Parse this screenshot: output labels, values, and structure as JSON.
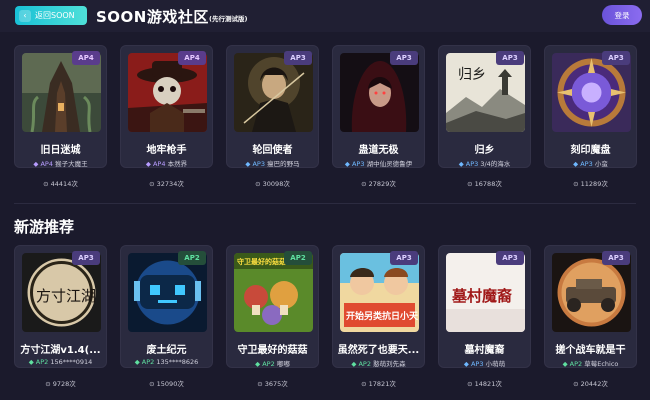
{
  "header": {
    "back_label": "返回SOON",
    "title": "SOON游戏社区",
    "subtitle": "(先行测试版)",
    "login_label": "登录"
  },
  "colors": {
    "background": "#1b1a2c",
    "card": "#2a2a3f",
    "accent_teal": "#19c0d6",
    "accent_purple": "#7b5fe8",
    "ap2_green": "#5fe0a0"
  },
  "top_games": [
    {
      "name": "旧日迷城",
      "tag": "AP4",
      "author_ver": "AP4",
      "author": "猴子大魔王",
      "plays": "44414次"
    },
    {
      "name": "地牢枪手",
      "tag": "AP4",
      "author_ver": "AP4",
      "author": "本然界",
      "plays": "32734次"
    },
    {
      "name": "轮回使者",
      "tag": "AP3",
      "author_ver": "AP3",
      "author": "瘦巴的野马",
      "plays": "30098次"
    },
    {
      "name": "蛊道无极",
      "tag": "AP3",
      "author_ver": "AP3",
      "author": "湖中仙灵德鲁伊",
      "plays": "27829次"
    },
    {
      "name": "归乡",
      "tag": "AP3",
      "author_ver": "AP3",
      "author": "3/4的海水",
      "plays": "16788次"
    },
    {
      "name": "刻印魔盘",
      "tag": "AP3",
      "author_ver": "AP3",
      "author": "小蛮",
      "plays": "11289次"
    }
  ],
  "new_section_title": "新游推荐",
  "new_games": [
    {
      "name": "方寸江湖v1.4(...",
      "tag": "AP3",
      "author_ver": "AP2",
      "author": "156****0914",
      "plays": "9728次"
    },
    {
      "name": "废土纪元",
      "tag": "AP2",
      "author_ver": "AP2",
      "author": "135****8626",
      "plays": "15090次"
    },
    {
      "name": "守卫最好的菇菇",
      "tag": "AP2",
      "author_ver": "AP2",
      "author": "嘟嘟",
      "plays": "3675次"
    },
    {
      "name": "虽然死了也要天...",
      "tag": "AP3",
      "author_ver": "AP2",
      "author": "憨萌刘先森",
      "plays": "17821次"
    },
    {
      "name": "墓村魔裔",
      "tag": "AP3",
      "author_ver": "AP3",
      "author": "小萌萌",
      "plays": "14821次"
    },
    {
      "name": "搓个战车就是干",
      "tag": "AP3",
      "author_ver": "AP2",
      "author": "草莓Echico",
      "plays": "20442次"
    }
  ],
  "thumb_text": {
    "guixiang": "归乡",
    "fangcun": "方寸江湖",
    "shouwei": "守卫最好的菇菇",
    "suiran": "开始另类抗日小天",
    "mucun": "墓村魔裔"
  }
}
